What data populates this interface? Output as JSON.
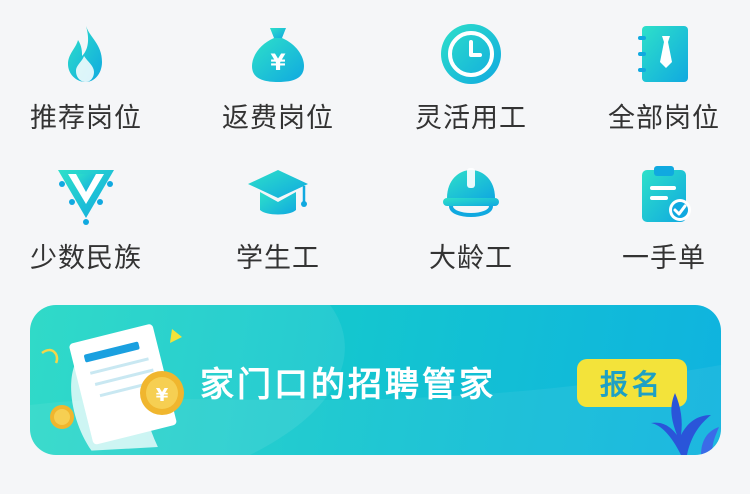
{
  "grid": {
    "items": [
      {
        "label": "推荐岗位",
        "icon": "fire-icon"
      },
      {
        "label": "返费岗位",
        "icon": "money-bag-icon"
      },
      {
        "label": "灵活用工",
        "icon": "clock-icon"
      },
      {
        "label": "全部岗位",
        "icon": "notebook-tie-icon"
      },
      {
        "label": "少数民族",
        "icon": "ethnic-collar-icon"
      },
      {
        "label": "学生工",
        "icon": "graduation-cap-icon"
      },
      {
        "label": "大龄工",
        "icon": "hard-hat-icon"
      },
      {
        "label": "一手单",
        "icon": "clipboard-check-icon"
      }
    ]
  },
  "banner": {
    "slogan": "家门口的招聘管家",
    "button_label": "报名"
  },
  "colors": {
    "icon_gradient_start": "#2ee0c9",
    "icon_gradient_end": "#10a9e0",
    "button_yellow": "#f3e33a"
  }
}
